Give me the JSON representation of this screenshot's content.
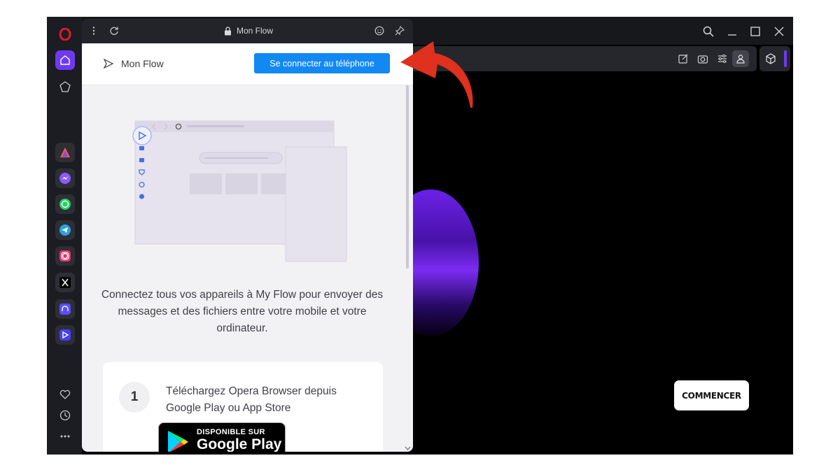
{
  "panel": {
    "header_title": "Mon Flow",
    "title": "Mon Flow",
    "connect_button": "Se connecter au téléphone",
    "description": "Connectez tous vos appareils à My Flow pour envoyer des messages et des fichiers entre votre mobile et votre ordinateur.",
    "step": {
      "number": "1",
      "text": "Téléchargez Opera Browser depuis Google Play ou App Store"
    },
    "google_play": {
      "small": "DISPONIBLE SUR",
      "big": "Google Play"
    }
  },
  "page": {
    "cta_label": "COMMENCER"
  },
  "sidebar": {
    "items": [
      "opera-logo",
      "home-icon",
      "pinboard-icon",
      "aria-icon",
      "messenger-icon",
      "whatsapp-icon",
      "telegram-icon",
      "instagram-icon",
      "x-icon",
      "music-player-icon",
      "flow-icon",
      "heart-icon",
      "history-icon",
      "more-icon"
    ]
  },
  "colors": {
    "accent": "#1289f2",
    "opera_red": "#e0192e",
    "sidebar_active": "#6d3af2",
    "annotation_arrow": "#e0301e"
  }
}
